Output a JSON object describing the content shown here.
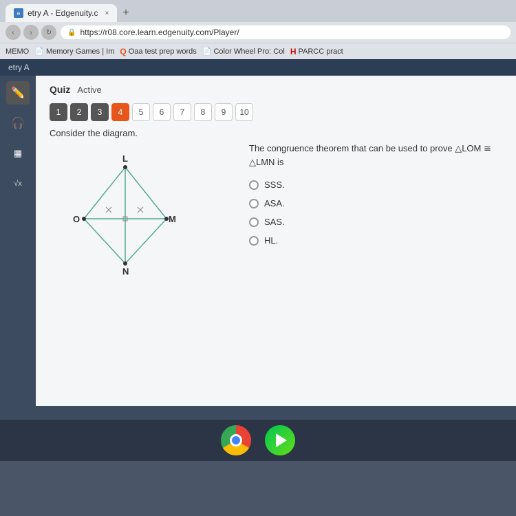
{
  "browser": {
    "tab_title": "etry A - Edgenuity.c",
    "tab_close": "×",
    "new_tab": "+",
    "address": "https://r08.core.learn.edgenuity.com/Player/",
    "lock_icon": "🔒",
    "bookmarks": [
      {
        "label": "MEMO",
        "icon": "doc"
      },
      {
        "label": "Memory Games | Im",
        "icon": "doc"
      },
      {
        "label": "Oaa test prep words",
        "icon": "q"
      },
      {
        "label": "Color Wheel Pro: Col",
        "icon": "doc"
      },
      {
        "label": "PARCC pract",
        "icon": "h"
      }
    ]
  },
  "app": {
    "header_title": "etry A",
    "quiz_label": "Quiz",
    "active_label": "Active",
    "question_numbers": [
      {
        "num": "1",
        "state": "answered"
      },
      {
        "num": "2",
        "state": "answered"
      },
      {
        "num": "3",
        "state": "answered"
      },
      {
        "num": "4",
        "state": "current"
      },
      {
        "num": "5",
        "state": "default"
      },
      {
        "num": "6",
        "state": "default"
      },
      {
        "num": "7",
        "state": "default"
      },
      {
        "num": "8",
        "state": "default"
      },
      {
        "num": "9",
        "state": "default"
      },
      {
        "num": "10",
        "state": "default"
      }
    ],
    "consider_text": "Consider the diagram.",
    "diagram_labels": {
      "L": "L",
      "O": "O",
      "M": "M",
      "N": "N"
    },
    "question_text": "The congruence theorem that can be used to prove △LOM ≅ △LMN is",
    "answers": [
      {
        "id": "sss",
        "label": "SSS."
      },
      {
        "id": "asa",
        "label": "ASA."
      },
      {
        "id": "sas",
        "label": "SAS."
      },
      {
        "id": "hl",
        "label": "HL."
      }
    ]
  },
  "sidebar_icons": [
    {
      "name": "pencil",
      "symbol": "✏️",
      "active": true
    },
    {
      "name": "headphones",
      "symbol": "🎧",
      "active": false
    },
    {
      "name": "calculator",
      "symbol": "🖩",
      "active": false
    },
    {
      "name": "formula",
      "symbol": "√x",
      "active": false
    }
  ],
  "taskbar": {
    "chrome_label": "Chrome",
    "play_label": "Play Store"
  }
}
